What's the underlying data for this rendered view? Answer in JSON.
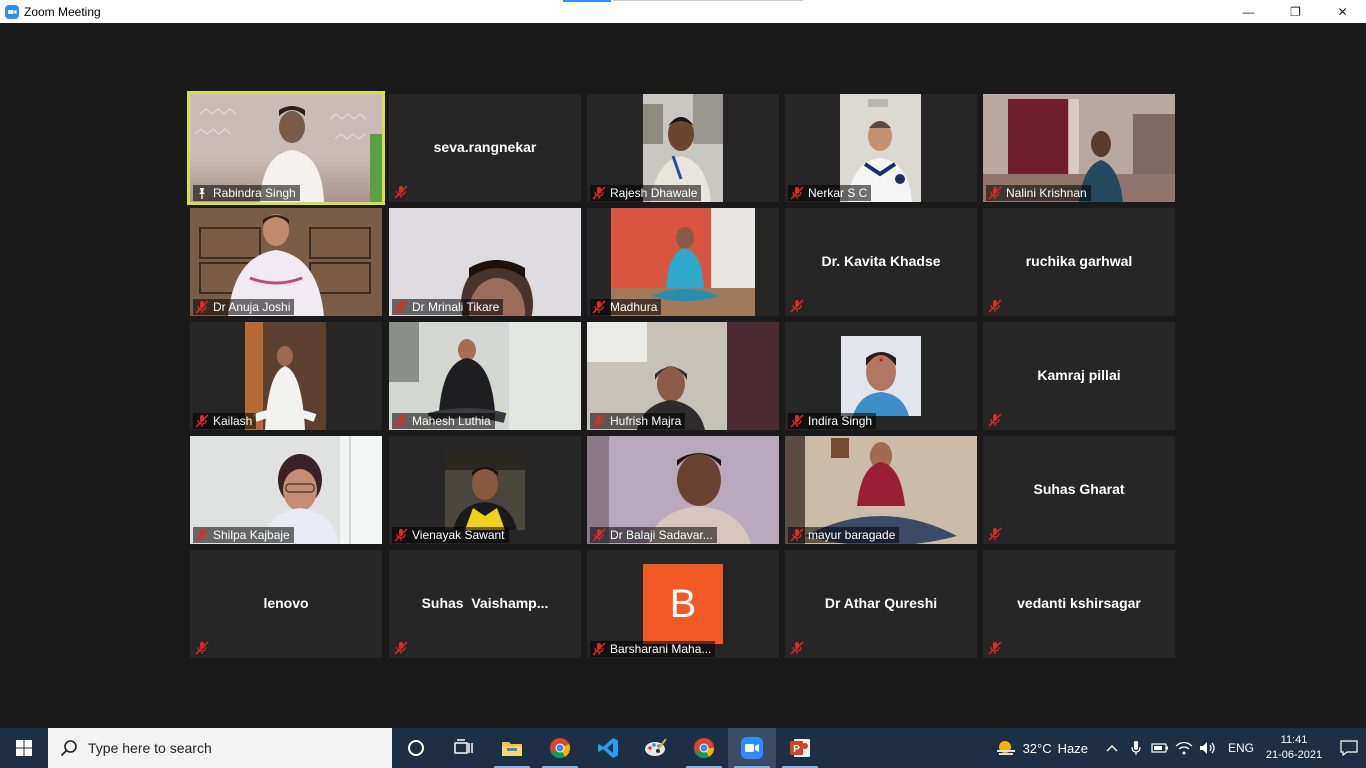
{
  "window": {
    "title": "Zoom Meeting",
    "minimize": "—",
    "maximize": "❐",
    "close": "✕"
  },
  "participants": [
    {
      "name": "Rabindra Singh",
      "video": true,
      "pinned": true,
      "active_speaker": true
    },
    {
      "name": "seva.rangnekar",
      "video": false
    },
    {
      "name": "Rajesh Dhawale",
      "video": true
    },
    {
      "name": "Nerkar S C",
      "video": true
    },
    {
      "name": "Nalini Krishnan",
      "video": true
    },
    {
      "name": "Dr Anuja Joshi",
      "video": true
    },
    {
      "name": "Dr Mrinali Tikare",
      "video": true
    },
    {
      "name": "Madhura",
      "video": true
    },
    {
      "name": "Dr. Kavita Khadse",
      "video": false
    },
    {
      "name": "ruchika garhwal",
      "video": false
    },
    {
      "name": "Kailash",
      "video": true
    },
    {
      "name": "Mahesh Luthia",
      "video": true
    },
    {
      "name": "Hufrish Majra",
      "video": true
    },
    {
      "name": "Indira Singh",
      "video": true
    },
    {
      "name": "Kamraj pillai",
      "video": false
    },
    {
      "name": "Shilpa Kajbaje",
      "video": true
    },
    {
      "name": "Vienayak Sawant",
      "video": true
    },
    {
      "name": "Dr Balaji Sadavar...",
      "video": true
    },
    {
      "name": "mayur baragade",
      "video": true
    },
    {
      "name": "Suhas Gharat",
      "video": false
    },
    {
      "name": "lenovo",
      "video": false
    },
    {
      "name": "Suhas  Vaishamp...",
      "video": false
    },
    {
      "name": "Barsharani Maha...",
      "video": false,
      "avatar_letter": "B"
    },
    {
      "name": "Dr Athar Qureshi",
      "video": false
    },
    {
      "name": "vedanti kshirsagar",
      "video": false
    }
  ],
  "taskbar": {
    "search_placeholder": "Type here to search",
    "weather_temp": "32°C",
    "weather_condition": "Haze",
    "language": "ENG",
    "time": "11:41",
    "date": "21-06-2021"
  },
  "colors": {
    "active_speaker_border": "#d3e04a",
    "tile_background": "#262626",
    "meeting_background": "#1a1a1a",
    "taskbar": "#1d2f45",
    "avatar_orange": "#f25a25",
    "muted_red": "#e02828"
  }
}
